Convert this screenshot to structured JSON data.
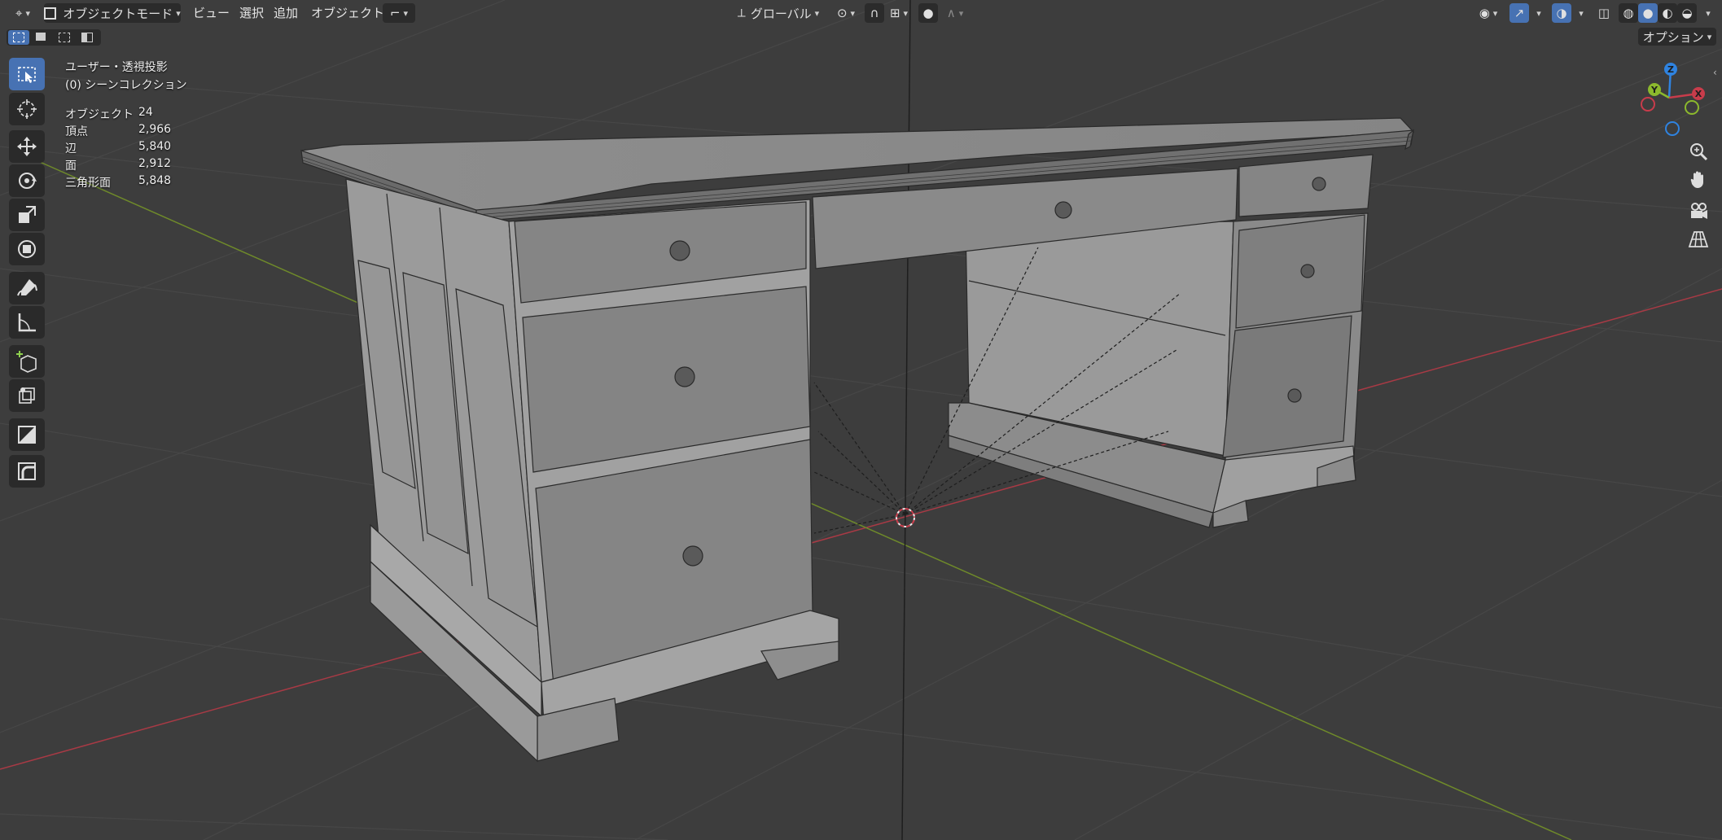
{
  "header": {
    "mode_label": "オブジェクトモード",
    "menus": [
      "ビュー",
      "選択",
      "追加",
      "オブジェクト"
    ],
    "transform_orientation": "グローバル",
    "options_label": "オプション"
  },
  "overlay": {
    "view_name": "ユーザー・透視投影",
    "collection": "(0) シーンコレクション",
    "stats": [
      {
        "label": "オブジェクト",
        "value": "24"
      },
      {
        "label": "頂点",
        "value": "2,966"
      },
      {
        "label": "辺",
        "value": "5,840"
      },
      {
        "label": "面",
        "value": "2,912"
      },
      {
        "label": "三角形面",
        "value": "5,848"
      }
    ]
  },
  "toolbar": {
    "tools": [
      "select-box",
      "cursor",
      "move",
      "rotate",
      "scale",
      "transform",
      "annotate",
      "measure",
      "add-cube",
      "add-object",
      "shrink",
      "bend"
    ],
    "active_tool": "select-box"
  },
  "gizmo": {
    "x_label": "X",
    "y_label": "Y",
    "z_label": "Z"
  },
  "colors": {
    "accent": "#4772b3",
    "axis_x": "#c83c4b",
    "axis_y": "#8cb92d",
    "axis_z": "#2f83e0",
    "background": "#3d3d3d",
    "grid": "#4a4a4a"
  }
}
